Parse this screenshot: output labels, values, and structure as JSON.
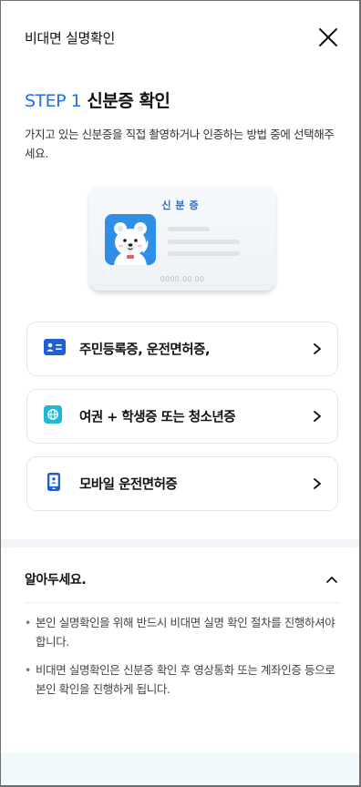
{
  "header": {
    "title": "비대면 실명확인",
    "close_icon": "close-icon"
  },
  "step": {
    "label": "STEP 1",
    "name": "신분증 확인",
    "description": "가지고 있는 신분증을 직접 촬영하거나 인증하는 방법 중에 선택해주세요."
  },
  "id_card": {
    "header": "신분증",
    "number": "0000.00.00"
  },
  "options": [
    {
      "label": "주민등록증, 운전면허증,",
      "icon": "id-card-icon"
    },
    {
      "label": "여권 + 학생증 또는 청소년증",
      "icon": "globe-icon"
    },
    {
      "label": "모바일 운전면허증",
      "icon": "mobile-license-icon"
    }
  ],
  "notice": {
    "title": "알아두세요.",
    "items": [
      "본인 실명확인을 위해 반드시 비대면 실명 확인 절차를 진행하셔야 합니다.",
      "비대면 실명확인은 신분증 확인 후 영상통화 또는 계좌인증 등으로 본인 확인을 진행하게 됩니다."
    ]
  },
  "colors": {
    "accent": "#1f6fe8",
    "globe_icon": "#20b8d3",
    "bottom_area": "#f0f9fc"
  }
}
